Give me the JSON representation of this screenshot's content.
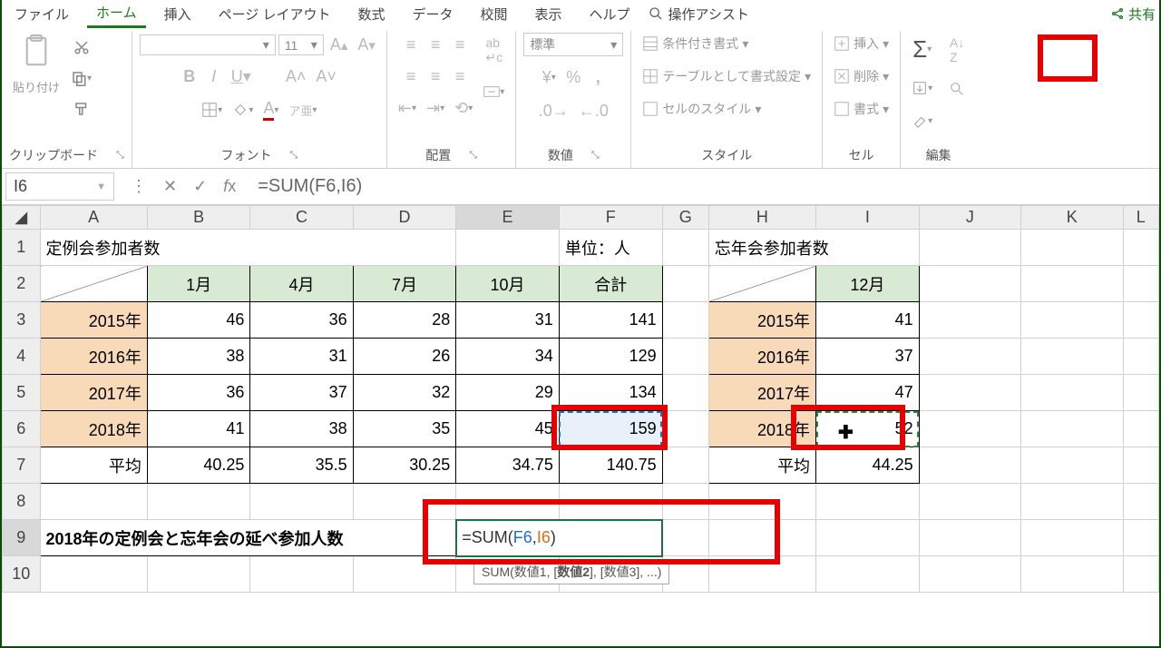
{
  "tabs": {
    "file": "ファイル",
    "home": "ホーム",
    "insert": "挿入",
    "layout": "ページ レイアウト",
    "formulas": "数式",
    "data": "データ",
    "review": "校閲",
    "view": "表示",
    "help": "ヘルプ",
    "tellme": "操作アシスト",
    "share": "共有"
  },
  "ribbon_groups": {
    "clipboard": "クリップボード",
    "font": "フォント",
    "alignment": "配置",
    "number": "数値",
    "styles": "スタイル",
    "cells": "セル",
    "editing": "編集"
  },
  "ribbon": {
    "paste": "貼り付け",
    "font_size": "11",
    "number_format": "標準",
    "conditional": "条件付き書式",
    "as_table": "テーブルとして書式設定",
    "cell_styles": "セルのスタイル",
    "insert": "挿入",
    "delete": "削除",
    "format": "書式"
  },
  "name_box": "I6",
  "formula_bar": "=SUM(F6,I6)",
  "columns": [
    "A",
    "B",
    "C",
    "D",
    "E",
    "F",
    "G",
    "H",
    "I",
    "J",
    "K",
    "L"
  ],
  "rows": [
    "1",
    "2",
    "3",
    "4",
    "5",
    "6",
    "7",
    "8",
    "9",
    "10"
  ],
  "table1": {
    "title": "定例会参加者数",
    "unit": "単位：人",
    "headers": [
      "1月",
      "4月",
      "7月",
      "10月",
      "合計"
    ],
    "years": [
      "2015年",
      "2016年",
      "2017年",
      "2018年",
      "平均"
    ],
    "data": [
      [
        "46",
        "36",
        "28",
        "31",
        "141"
      ],
      [
        "38",
        "31",
        "26",
        "34",
        "129"
      ],
      [
        "36",
        "37",
        "32",
        "29",
        "134"
      ],
      [
        "41",
        "38",
        "35",
        "45",
        "159"
      ],
      [
        "40.25",
        "35.5",
        "30.25",
        "34.75",
        "140.75"
      ]
    ]
  },
  "table2": {
    "title": "忘年会参加者数",
    "headers": [
      "12月"
    ],
    "years": [
      "2015年",
      "2016年",
      "2017年",
      "2018年",
      "平均"
    ],
    "data": [
      [
        "41"
      ],
      [
        "37"
      ],
      [
        "47"
      ],
      [
        "52"
      ],
      [
        "44.25"
      ]
    ]
  },
  "row9_label": "2018年の定例会と忘年会の延べ参加人数",
  "row9_formula_prefix": "=SUM(",
  "row9_ref1": "F6",
  "row9_comma": ",",
  "row9_ref2": "I6",
  "row9_suffix": ")",
  "tooltip": {
    "fn": "SUM(",
    "a1": "数値1",
    "sep": ", [",
    "a2": "数値2",
    "sep2": "], [数値3], ...)"
  },
  "col_widths": {
    "A": 120,
    "B": 115,
    "C": 115,
    "D": 115,
    "E": 115,
    "F": 115,
    "G": 52,
    "H": 120,
    "I": 115,
    "J": 115,
    "K": 115,
    "L": 40
  }
}
